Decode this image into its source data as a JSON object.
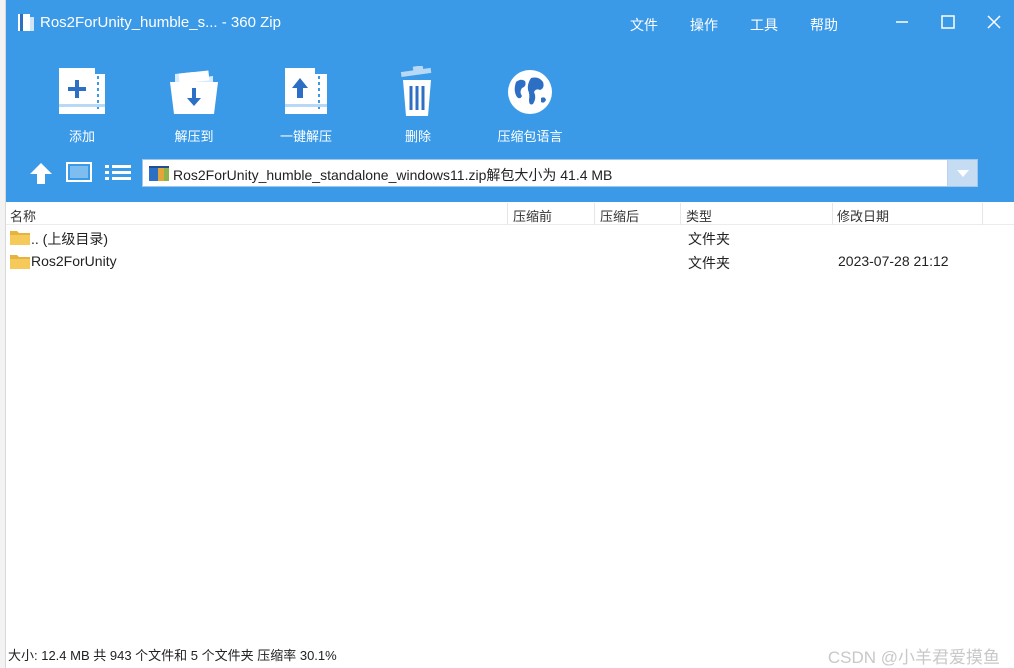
{
  "window": {
    "title": "Ros2ForUnity_humble_s... - 360 Zip",
    "menu": [
      "文件",
      "操作",
      "工具",
      "帮助"
    ]
  },
  "toolbar": {
    "add_label": "添加",
    "extract_to_label": "解压到",
    "one_click_extract_label": "一键解压",
    "delete_label": "删除",
    "language_label": "压缩包语言"
  },
  "nav": {
    "path": "Ros2ForUnity_humble_standalone_windows11.zip解包大小为 41.4 MB"
  },
  "columns": {
    "name": "名称",
    "compressed": "压缩前",
    "uncompressed": "压缩后",
    "type": "类型",
    "modified": "修改日期"
  },
  "files": [
    {
      "name": ".. (上级目录)",
      "type": "文件夹",
      "modified": ""
    },
    {
      "name": "Ros2ForUnity",
      "type": "文件夹",
      "modified": "2023-07-28 21:12"
    }
  ],
  "status": {
    "text": "大小: 12.4 MB 共 943 个文件和 5 个文件夹 压缩率 30.1%"
  },
  "watermark": "CSDN @小羊君爱摸鱼",
  "colors": {
    "accent": "#3a9ae8",
    "folder": "#f2c04c"
  }
}
